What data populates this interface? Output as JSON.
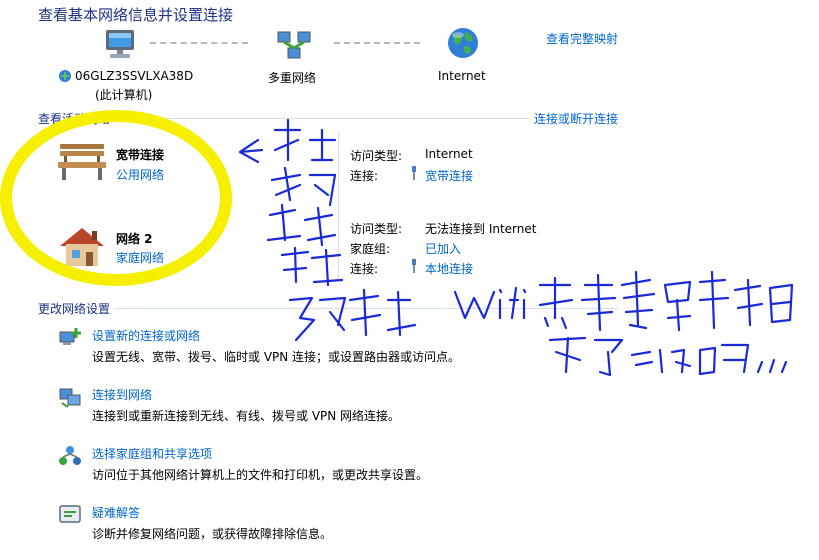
{
  "header": {
    "title": "查看基本网络信息并设置连接",
    "full_map_link": "查看完整映射"
  },
  "map": {
    "computer_name": "06GLZ3SSVLXA38D",
    "computer_sub": "(此计算机)",
    "multi_network": "多重网络",
    "internet": "Internet"
  },
  "active": {
    "section_title": "查看活动网络",
    "connect_link": "连接或断开连接",
    "networks": [
      {
        "name": "宽带连接",
        "category": "公用网络",
        "access_type_label": "访问类型:",
        "access_type_value": "Internet",
        "connection_label": "连接:",
        "connection_value": "宽带连接"
      },
      {
        "name": "网络  2",
        "category": "家庭网络",
        "access_type_label": "访问类型:",
        "access_type_value": "无法连接到 Internet",
        "homegroup_label": "家庭组:",
        "homegroup_value": "已加入",
        "connection_label": "连接:",
        "connection_value": "本地连接"
      }
    ]
  },
  "change": {
    "section_title": "更改网络设置",
    "items": [
      {
        "link": "设置新的连接或网络",
        "desc": "设置无线、宽带、拨号、临时或 VPN 连接；或设置路由器或访问点。"
      },
      {
        "link": "连接到网络",
        "desc": "连接到或重新连接到无线、有线、拨号或 VPN 网络连接。"
      },
      {
        "link": "选择家庭组和共享选项",
        "desc": "访问位于其他网络计算机上的文件和打印机，或更改共享设置。"
      },
      {
        "link": "疑难解答",
        "desc": "诊断并修复网络问题，或获得故障排除信息。"
      }
    ]
  },
  "colors": {
    "link": "#0066cc",
    "heading": "#1e3287",
    "annotation_ink": "#1a2ad8",
    "highlight": "#f6f000"
  }
}
